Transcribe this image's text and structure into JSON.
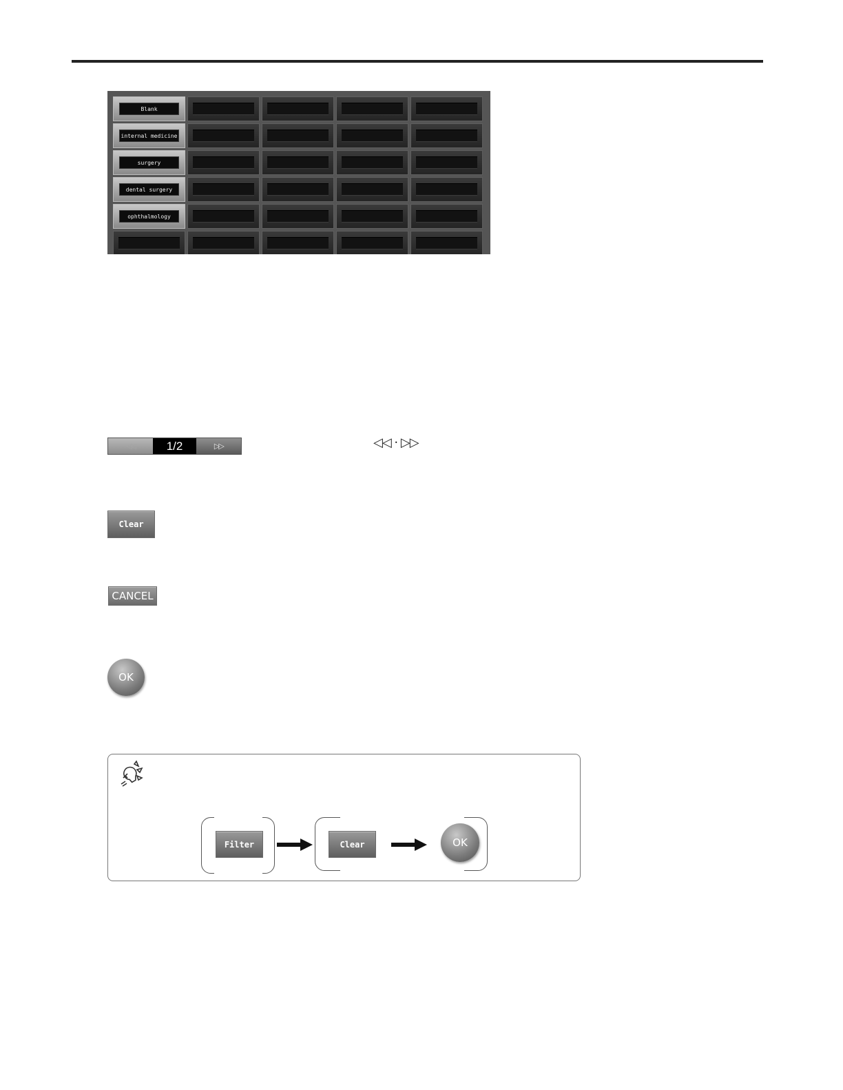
{
  "filter_grid": {
    "rows": [
      [
        "Blank",
        "",
        "",
        "",
        ""
      ],
      [
        "internal medicine",
        "",
        "",
        "",
        ""
      ],
      [
        "surgery",
        "",
        "",
        "",
        ""
      ],
      [
        "dental surgery",
        "",
        "",
        "",
        ""
      ],
      [
        "ophthalmology",
        "",
        "",
        "",
        ""
      ],
      [
        "",
        "",
        "",
        "",
        ""
      ]
    ]
  },
  "pager": {
    "prev_label": "◁◁",
    "page_indicator": "1/2",
    "next_label": "▷▷",
    "caption": "◁◁ · ▷▷"
  },
  "buttons": {
    "clear": "Clear",
    "cancel": "CANCEL",
    "ok": "OK"
  },
  "hint": {
    "icon": "lightbulb-icon",
    "step1_button": "Filter",
    "step2_button": "Clear",
    "step3_button": "OK"
  }
}
